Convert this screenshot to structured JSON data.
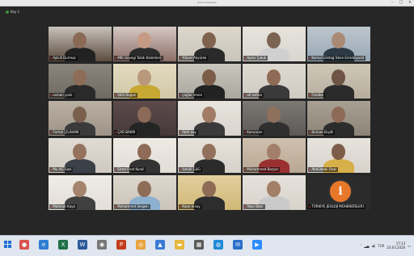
{
  "window": {
    "title": "Zoom Toplantısı",
    "info_label": "Kay 1"
  },
  "participants": [
    {
      "name": "Ayb B Durmaz",
      "bg": "#5b4b3e",
      "wall": "#c8c3bb",
      "head": "#8a6a55",
      "body": "#222222"
    },
    {
      "name": "MİS Güvegi Takdı Kalemleri",
      "bg": "#8e6e68",
      "wall": "#d5c9c4",
      "head": "#c59b85",
      "body": "#2b2b2b"
    },
    {
      "name": "Yüksel Akyürek",
      "bg": "#c9c4ba",
      "wall": "#ddd7cc",
      "head": "#7f634f",
      "body": "#2a2a2a"
    },
    {
      "name": "Ayzar Çaluk",
      "bg": "#d8d6cf",
      "wall": "#e6e3dc",
      "head": "#7c6454",
      "body": "#d0d0d0"
    },
    {
      "name": "Kemal Göktağ İsken Emirbeyvail",
      "bg": "#98a8b6",
      "wall": "#bcc6cd",
      "head": "#a98a75",
      "body": "#2c3a45",
      "active": true
    },
    {
      "name": "osman şank",
      "bg": "#6f6a62",
      "wall": "#8b857c",
      "head": "#8e6d58",
      "body": "#2a2a2a"
    },
    {
      "name": "falih Doğan",
      "bg": "#d2c8a8",
      "wall": "#e2dbc0",
      "head": "#b9987b",
      "body": "#c7a832"
    },
    {
      "name": "çağlar ersen",
      "bg": "#aaa79f",
      "wall": "#c9c6be",
      "head": "#7b5d48",
      "body": "#222222"
    },
    {
      "name": "ali sertan",
      "bg": "#cfcbc2",
      "wall": "#dedad2",
      "head": "#8f6b55",
      "body": "#3a3a3a"
    },
    {
      "name": "Fatalbe",
      "bg": "#b7ae9e",
      "wall": "#cfc7b8",
      "head": "#6e5444",
      "body": "#2b2b2b"
    },
    {
      "name": "Ferhat ÇİLAHAN",
      "bg": "#9d9387",
      "wall": "#b9afa2",
      "head": "#7a5f4d",
      "body": "#3b3b3b"
    },
    {
      "name": "ÇAĞ BAKIR",
      "bg": "#45383a",
      "wall": "#5e4b4b",
      "head": "#8b6a58",
      "body": "#242424"
    },
    {
      "name": "fatih key",
      "bg": "#d9d4cd",
      "wall": "#e8e4de",
      "head": "#a07c66",
      "body": "#3a3a3a"
    },
    {
      "name": "Kanvaran",
      "bg": "#5d5a57",
      "wall": "#7c7874",
      "head": "#8f715d",
      "body": "#2f2f2f"
    },
    {
      "name": "Bürkan Ekşilli",
      "bg": "#8d8478",
      "wall": "#a9a094",
      "head": "#8d6a55",
      "body": "#2c2c2c"
    },
    {
      "name": "Mu AG Gazi",
      "bg": "#cfc9c0",
      "wall": "#e0dbd4",
      "head": "#94725d",
      "body": "#3c4048"
    },
    {
      "name": "Emre Fırat Kural",
      "bg": "#e2ddd6",
      "wall": "#eeeae4",
      "head": "#8e6c57",
      "body": "#333333"
    },
    {
      "name": "Ismail Gülü",
      "bg": "#d6d1ca",
      "wall": "#e7e3dc",
      "head": "#92705b",
      "body": "#2b2b2b"
    },
    {
      "name": "Muhammed Bozyar",
      "bg": "#b9a793",
      "wall": "#cfc0ae",
      "head": "#a27f68",
      "body": "#9b3030"
    },
    {
      "name": "Abdülbaki Oval",
      "bg": "#d7d2cb",
      "wall": "#e7e3dd",
      "head": "#7d5d49",
      "body": "#d8b04a"
    },
    {
      "name": "Mahmut Kaya",
      "bg": "#e3ded7",
      "wall": "#efebe6",
      "head": "#a6836c",
      "body": "#404040"
    },
    {
      "name": "Muhammet Sergen",
      "bg": "#cbc4b8",
      "wall": "#ddd7cd",
      "head": "#8e6d58",
      "body": "#8db0cf"
    },
    {
      "name": "Kaan ersoy",
      "bg": "#d1b878",
      "wall": "#e2cf9c",
      "head": "#8d6b55",
      "body": "#2d2d2d"
    },
    {
      "name": "İlkan Batır",
      "bg": "#d8d2cb",
      "wall": "#e6e1db",
      "head": "#a28068",
      "body": "#c9c9c9"
    },
    {
      "name": "TÜRKİYE JEOLOJİ MÜHENDİSLERİ",
      "bg": "#2b2b2b",
      "wall": "#2b2b2b",
      "logo": "i"
    }
  ],
  "taskbar": {
    "apps": [
      {
        "icon": "chrome-icon",
        "color": "#d9534f",
        "glyph": "●"
      },
      {
        "icon": "edge-icon",
        "color": "#2d7dd2",
        "glyph": "e"
      },
      {
        "icon": "excel-icon",
        "color": "#1e7145",
        "glyph": "X"
      },
      {
        "icon": "word-icon",
        "color": "#2b579a",
        "glyph": "W"
      },
      {
        "icon": "disk-icon",
        "color": "#777777",
        "glyph": "◉"
      },
      {
        "icon": "powerpoint-icon",
        "color": "#c43e1c",
        "glyph": "P"
      },
      {
        "icon": "chrome-alt-icon",
        "color": "#e8a33d",
        "glyph": "◎"
      },
      {
        "icon": "photos-icon",
        "color": "#3a7bd5",
        "glyph": "▲"
      },
      {
        "icon": "folder-icon",
        "color": "#e6b83b",
        "glyph": "▬"
      },
      {
        "icon": "calculator-icon",
        "color": "#5a5a5a",
        "glyph": "▦"
      },
      {
        "icon": "globe-icon",
        "color": "#1f8ad6",
        "glyph": "◍"
      },
      {
        "icon": "mail-icon",
        "color": "#2a6fc9",
        "glyph": "✉"
      },
      {
        "icon": "zoom-icon",
        "color": "#2d8cff",
        "glyph": "▶"
      }
    ],
    "time": "17:13",
    "date": "23.03.2020",
    "language": "TUR"
  }
}
